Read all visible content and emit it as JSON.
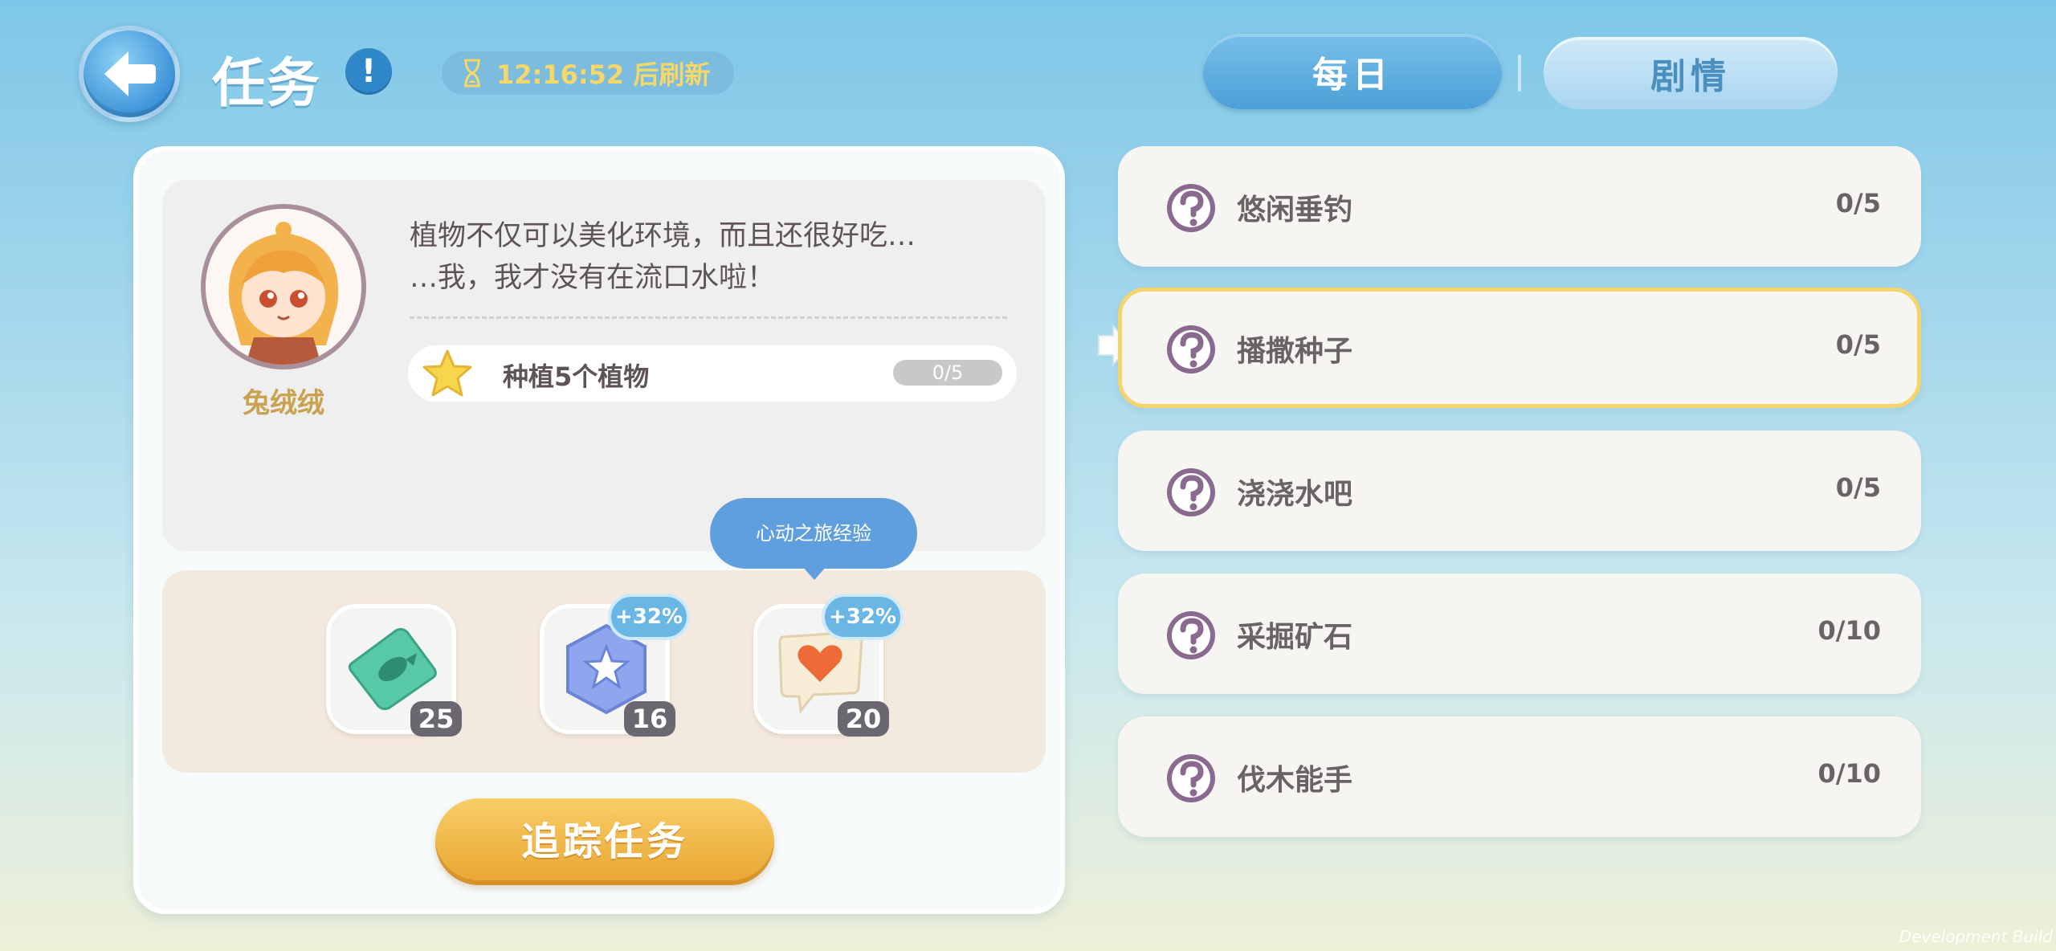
{
  "header": {
    "title": "任务",
    "info_symbol": "!",
    "refresh_text": "12:16:52 后刷新"
  },
  "tabs": [
    {
      "label": "每日",
      "active": true
    },
    {
      "label": "剧情",
      "active": false
    }
  ],
  "detail": {
    "npc_name": "兔绒绒",
    "dialog_line1": "植物不仅可以美化环境，而且还很好吃…",
    "dialog_line2": "…我，我才没有在流口水啦！",
    "objective_label": "种植5个植物",
    "objective_progress": "0/5",
    "tooltip": "心动之旅经验",
    "rewards": [
      {
        "icon": "fish-ticket-icon",
        "count": "25",
        "bonus": ""
      },
      {
        "icon": "star-hexagon-icon",
        "count": "16",
        "bonus": "+32%"
      },
      {
        "icon": "heart-chat-icon",
        "count": "20",
        "bonus": "+32%"
      }
    ],
    "track_button": "追踪任务"
  },
  "quests": [
    {
      "label": "悠闲垂钓",
      "progress": "0/5"
    },
    {
      "label": "播撒种子",
      "progress": "0/5",
      "selected": true
    },
    {
      "label": "浇浇水吧",
      "progress": "0/5"
    },
    {
      "label": "采掘矿石",
      "progress": "0/10"
    },
    {
      "label": "伐木能手",
      "progress": "0/10"
    }
  ],
  "watermark": "Development Build",
  "colors": {
    "accent_blue": "#4c9fd7",
    "gold_button": "#e9a631",
    "selected_border": "#f5d56b",
    "name_gold": "#c8a24f"
  }
}
